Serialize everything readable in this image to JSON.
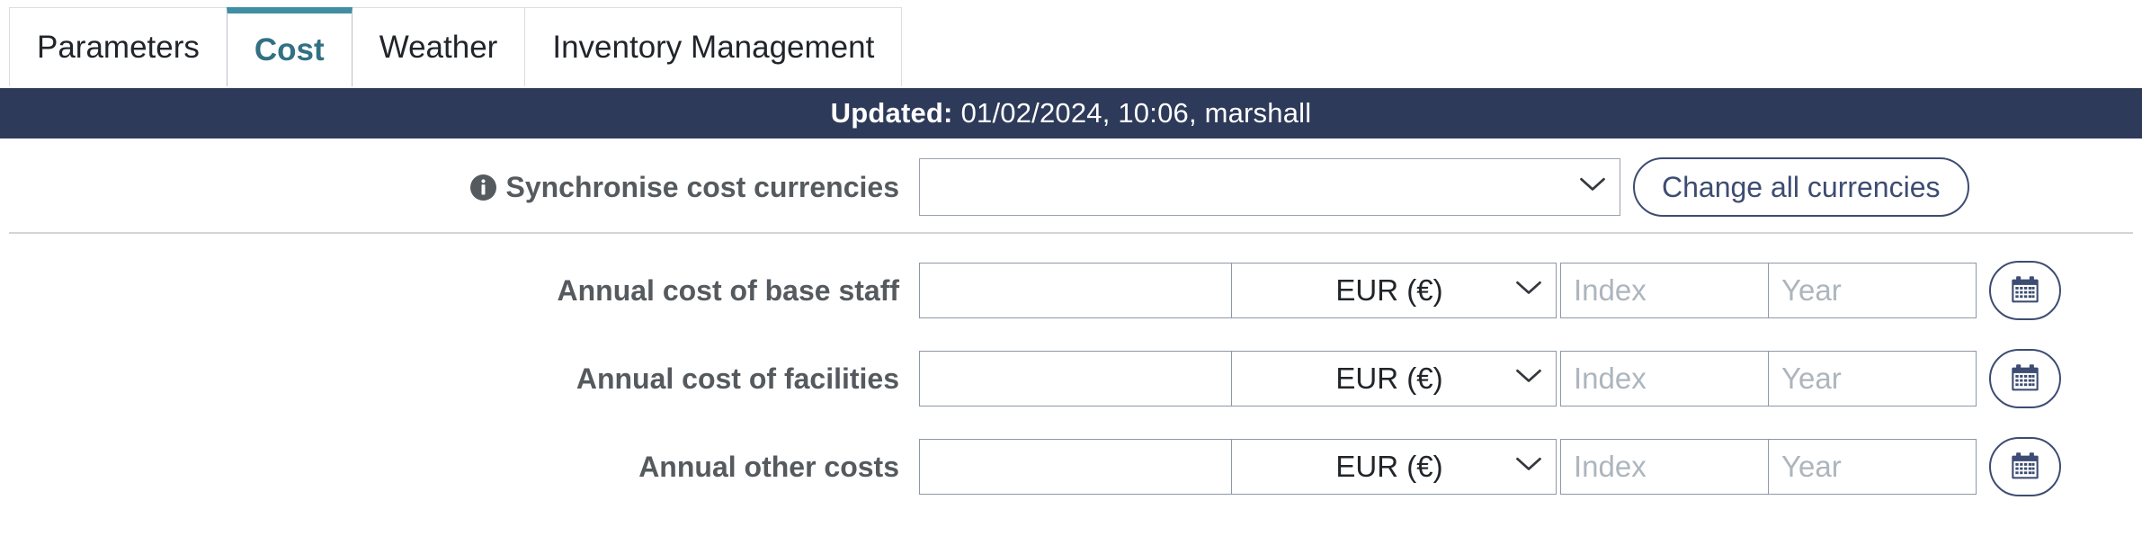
{
  "tabs": [
    {
      "label": "Parameters",
      "active": false
    },
    {
      "label": "Cost",
      "active": true
    },
    {
      "label": "Weather",
      "active": false
    },
    {
      "label": "Inventory Management",
      "active": false
    }
  ],
  "updated_bar": {
    "label": "Updated:",
    "value": "01/02/2024, 10:06, marshall"
  },
  "sync_row": {
    "info_icon": "info-circle-icon",
    "label": "Synchronise cost currencies",
    "select_value": "",
    "select_placeholder": "",
    "chevron_icon": "chevron-down-icon",
    "button_label": "Change all currencies"
  },
  "cost_rows": [
    {
      "label": "Annual cost of base staff",
      "value": "",
      "value_placeholder": "",
      "currency": "EUR (€)",
      "index_placeholder": "Index",
      "index_value": "",
      "year_placeholder": "Year",
      "year_value": "",
      "calendar_icon": "calendar-icon"
    },
    {
      "label": "Annual cost of facilities",
      "value": "",
      "value_placeholder": "",
      "currency": "EUR (€)",
      "index_placeholder": "Index",
      "index_value": "",
      "year_placeholder": "Year",
      "year_value": "",
      "calendar_icon": "calendar-icon"
    },
    {
      "label": "Annual other costs",
      "value": "",
      "value_placeholder": "",
      "currency": "EUR (€)",
      "index_placeholder": "Index",
      "index_value": "",
      "year_placeholder": "Year",
      "year_value": "",
      "calendar_icon": "calendar-icon"
    }
  ],
  "colors": {
    "banner_navy": "#2e3a59",
    "active_tab_teal": "#317183",
    "active_tab_border": "#3f8ea3",
    "button_navy": "#3d4c72",
    "label_gray": "#555a5e",
    "placeholder_gray": "#adb5bd",
    "input_border": "#8e97a8",
    "divider_gray": "#d4d4d4"
  }
}
